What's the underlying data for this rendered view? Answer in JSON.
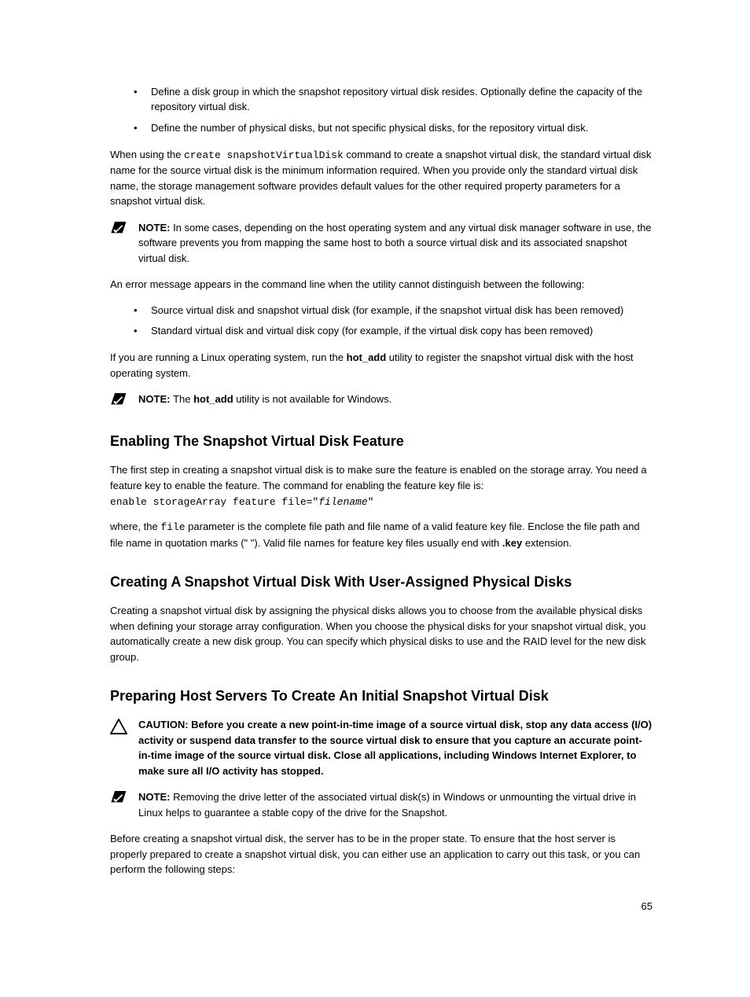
{
  "bullets_top": [
    "Define a disk group in which the snapshot repository virtual disk resides. Optionally define the capacity of the repository virtual disk.",
    "Define the number of physical disks, but not specific physical disks, for the repository virtual disk."
  ],
  "para1_a": "When using the ",
  "para1_cmd": "create snapshotVirtualDisk",
  "para1_b": " command to create a snapshot virtual disk, the standard virtual disk name for the source virtual disk is the minimum information required. When you provide only the standard virtual disk name, the storage management software provides default values for the other required property parameters for a snapshot virtual disk.",
  "note1_label": "NOTE: ",
  "note1_text": "In some cases, depending on the host operating system and any virtual disk manager software in use, the software prevents you from mapping the same host to both a source virtual disk and its associated snapshot virtual disk.",
  "para2": "An error message appears in the command line when the utility cannot distinguish between the following:",
  "bullets_mid": [
    "Source virtual disk and snapshot virtual disk (for example, if the snapshot virtual disk has been removed)",
    "Standard virtual disk and virtual disk copy (for example, if the virtual disk copy has been removed)"
  ],
  "para3_a": "If you are running a Linux operating system, run the ",
  "para3_bold": "hot_add",
  "para3_b": " utility to register the snapshot virtual disk with the host operating system.",
  "note2_label": "NOTE: ",
  "note2_a": "The ",
  "note2_bold": "hot_add",
  "note2_b": " utility is not available for Windows.",
  "h2a": "Enabling The Snapshot Virtual Disk Feature",
  "para4": "The first step in creating a snapshot virtual disk is to make sure the feature is enabled on the storage array. You need a feature key to enable the feature. The command for enabling the feature key file is:",
  "code_a": "enable storageArray feature file=\"",
  "code_ital": "filename",
  "code_b": "\"",
  "para5_a": "where, the ",
  "para5_mono": "file",
  "para5_b": " parameter is the complete file path and file name of a valid feature key file. Enclose the file path and file name in quotation marks (\" \"). Valid file names for feature key files usually end with ",
  "para5_bold": ".key",
  "para5_c": " extension.",
  "h2b": "Creating A Snapshot Virtual Disk With User-Assigned Physical Disks",
  "para6": "Creating a snapshot virtual disk by assigning the physical disks allows you to choose from the available physical disks when defining your storage array configuration. When you choose the physical disks for your snapshot virtual disk, you automatically create a new disk group. You can specify which physical disks to use and the RAID level for the new disk group.",
  "h2c": "Preparing Host Servers To Create An Initial Snapshot Virtual Disk",
  "caution_label": "CAUTION: ",
  "caution_text": "Before you create a new point-in-time image of a source virtual disk, stop any data access (I/O) activity or suspend data transfer to the source virtual disk to ensure that you capture an accurate point-in-time image of the source virtual disk. Close all applications, including Windows Internet Explorer, to make sure all I/O activity has stopped.",
  "note3_label": "NOTE: ",
  "note3_text": "Removing the drive letter of the associated virtual disk(s) in Windows or unmounting the virtual drive in Linux helps to guarantee a stable copy of the drive for the Snapshot.",
  "para7": "Before creating a snapshot virtual disk, the server has to be in the proper state. To ensure that the host server is properly prepared to create a snapshot virtual disk, you can either use an application to carry out this task, or you can perform the following steps:",
  "page_number": "65"
}
